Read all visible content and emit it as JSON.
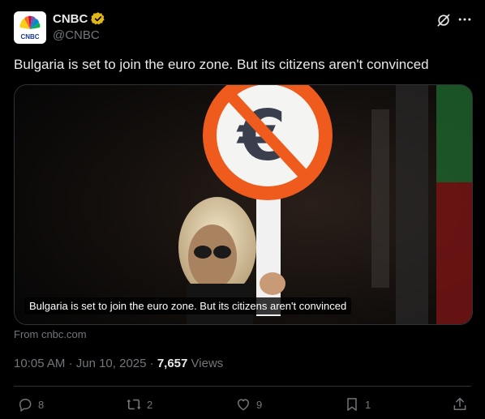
{
  "account": {
    "name": "CNBC",
    "handle": "@CNBC",
    "logo_text": "CNBC"
  },
  "tweet": {
    "text": "Bulgaria is set to join the euro zone. But its citizens aren't convinced"
  },
  "card": {
    "caption": "Bulgaria is set to join the euro zone. But its citizens aren't convinced",
    "source": "From cnbc.com"
  },
  "meta": {
    "time": "10:05 AM",
    "date": "Jun 10, 2025",
    "views_count": "7,657",
    "views_label": "Views",
    "sep": "·"
  },
  "actions": {
    "replies": "8",
    "reposts": "2",
    "likes": "9",
    "bookmarks": "1"
  },
  "icons": [
    "verified-icon",
    "grok-icon",
    "more-icon",
    "reply-icon",
    "repost-icon",
    "like-icon",
    "bookmark-icon",
    "share-icon"
  ],
  "colors": {
    "background": "#000000",
    "text": "#e7e9ea",
    "muted": "#71767b",
    "verified": "#e2b719"
  }
}
